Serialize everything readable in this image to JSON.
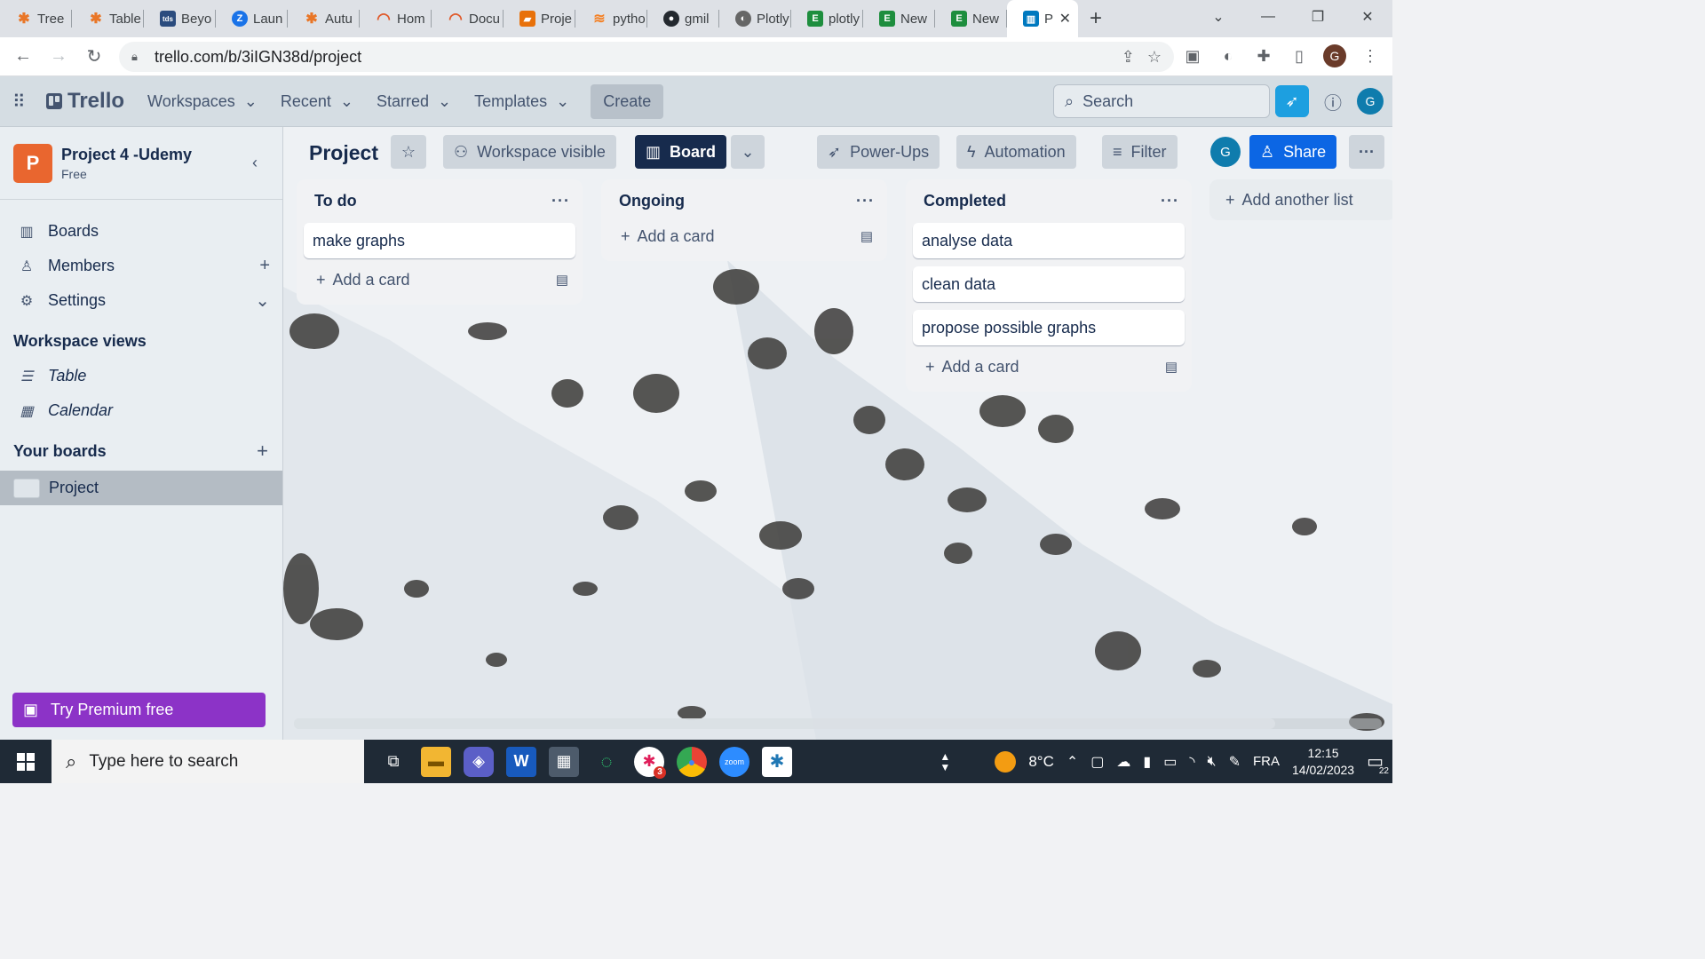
{
  "browser": {
    "tabs": [
      {
        "label": "Tree",
        "icon": "tableau-icon",
        "color": "#e97627"
      },
      {
        "label": "Table",
        "icon": "tableau-icon",
        "color": "#e97627"
      },
      {
        "label": "Beyo",
        "icon": "tds-icon",
        "color": "#2b4c7e"
      },
      {
        "label": "Laun",
        "icon": "z-icon",
        "color": "#1a73e8"
      },
      {
        "label": "Autu",
        "icon": "tableau-icon",
        "color": "#e97627"
      },
      {
        "label": "Hom",
        "icon": "udemy-icon",
        "color": "#e05a2b"
      },
      {
        "label": "Docu",
        "icon": "udemy-icon",
        "color": "#e05a2b"
      },
      {
        "label": "Proje",
        "icon": "notebook-icon",
        "color": "#e8710a"
      },
      {
        "label": "pytho",
        "icon": "stack-icon",
        "color": "#f48024"
      },
      {
        "label": "gmil",
        "icon": "github-icon",
        "color": "#24292f"
      },
      {
        "label": "Plotly",
        "icon": "plotly-icon",
        "color": "#555"
      },
      {
        "label": "plotly",
        "icon": "e-icon",
        "color": "#1e8e3e"
      },
      {
        "label": "New",
        "icon": "e-icon",
        "color": "#1e8e3e"
      },
      {
        "label": "New",
        "icon": "e-icon",
        "color": "#1e8e3e"
      },
      {
        "label": "P",
        "icon": "trello-icon",
        "color": "#0079bf"
      }
    ],
    "url": "trello.com/b/3iIGN38d/project",
    "profile_initial": "G"
  },
  "header": {
    "logo": "Trello",
    "menu": [
      "Workspaces",
      "Recent",
      "Starred",
      "Templates"
    ],
    "create": "Create",
    "search_placeholder": "Search",
    "avatar": "G"
  },
  "sidebar": {
    "workspace_initial": "P",
    "workspace_name": "Project 4 -Udemy",
    "workspace_plan": "Free",
    "items": [
      {
        "label": "Boards",
        "icon": "board-icon"
      },
      {
        "label": "Members",
        "icon": "person-icon"
      },
      {
        "label": "Settings",
        "icon": "gear-icon"
      }
    ],
    "views_heading": "Workspace views",
    "views": [
      "Table",
      "Calendar"
    ],
    "boards_heading": "Your boards",
    "boards": [
      "Project"
    ],
    "premium": "Try Premium free"
  },
  "board": {
    "title": "Project",
    "visibility": "Workspace visible",
    "view": "Board",
    "powerups": "Power-Ups",
    "automation": "Automation",
    "filter": "Filter",
    "member_avatar": "G",
    "share": "Share",
    "lists": [
      {
        "title": "To do",
        "cards": [
          "make graphs"
        ],
        "add": "Add a card"
      },
      {
        "title": "Ongoing",
        "cards": [],
        "add": "Add a card"
      },
      {
        "title": "Completed",
        "cards": [
          "analyse data",
          "clean data",
          "propose possible graphs"
        ],
        "add": "Add a card"
      }
    ],
    "add_list": "Add another list"
  },
  "taskbar": {
    "search_placeholder": "Type here to search",
    "weather": "8°C",
    "lang": "FRA",
    "time": "12:15",
    "date": "14/02/2023",
    "notifications": "22",
    "slack_badge": "3"
  }
}
